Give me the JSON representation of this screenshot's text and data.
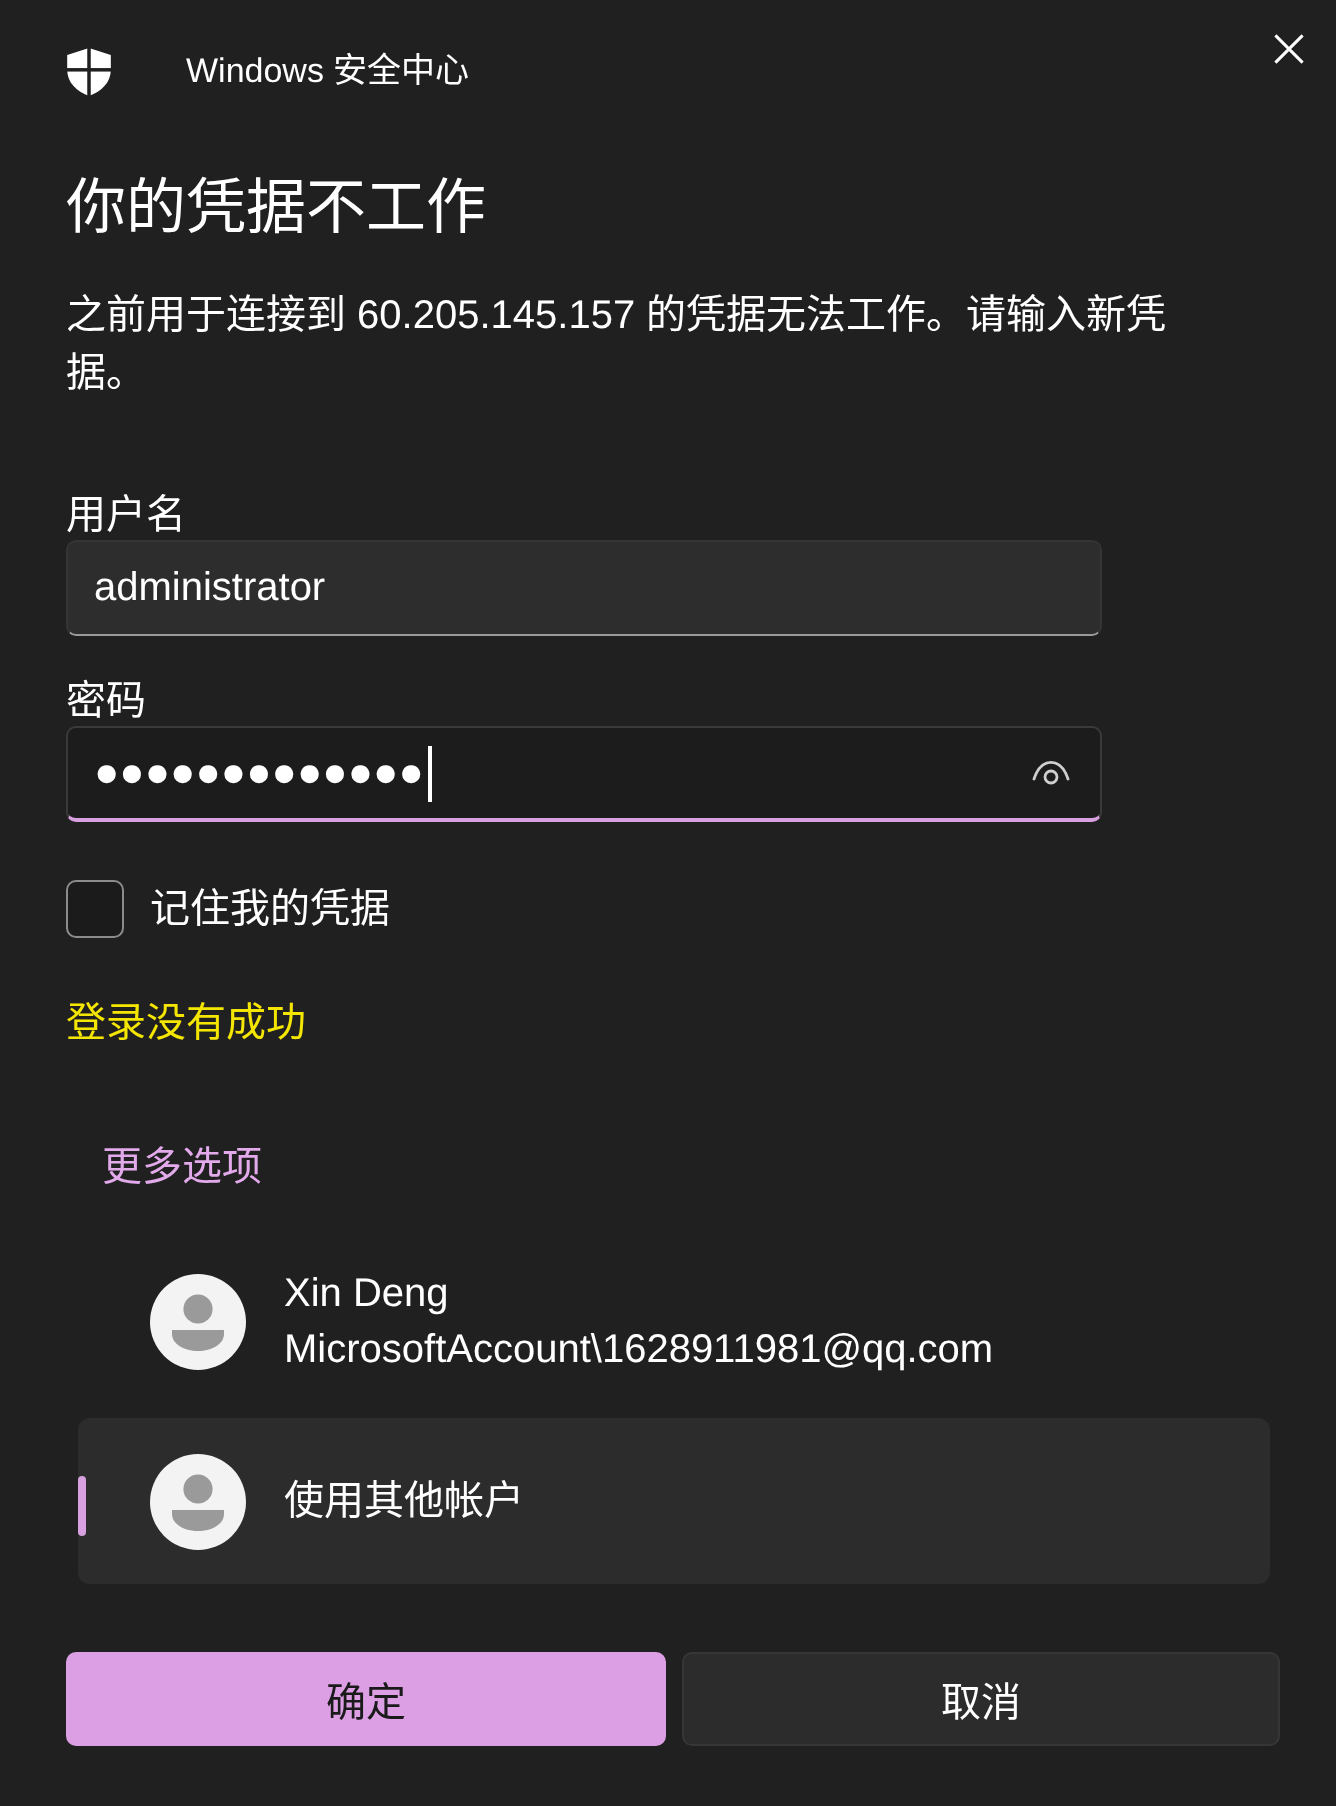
{
  "window": {
    "title": "Windows 安全中心"
  },
  "heading": "你的凭据不工作",
  "message": "之前用于连接到 60.205.145.157 的凭据无法工作。请输入新凭据。",
  "fields": [
    {
      "kind": "text",
      "label": "用户名",
      "value": "administrator",
      "focused": false
    },
    {
      "kind": "password",
      "label": "密码",
      "value": "●●●●●●●●●●●●●",
      "focused": true
    }
  ],
  "remember": {
    "label": "记住我的凭据",
    "checked": false
  },
  "error": "登录没有成功",
  "more_options": {
    "label": "更多选项"
  },
  "accounts": [
    {
      "title": "Xin Deng",
      "subtitle": "MicrosoftAccount\\1628911981@qq.com",
      "selected": false
    },
    {
      "title": "使用其他帐户",
      "selected": true
    }
  ],
  "buttons": [
    {
      "kind": "primary",
      "label": "确定"
    },
    {
      "kind": "secondary",
      "label": "取消"
    }
  ]
}
